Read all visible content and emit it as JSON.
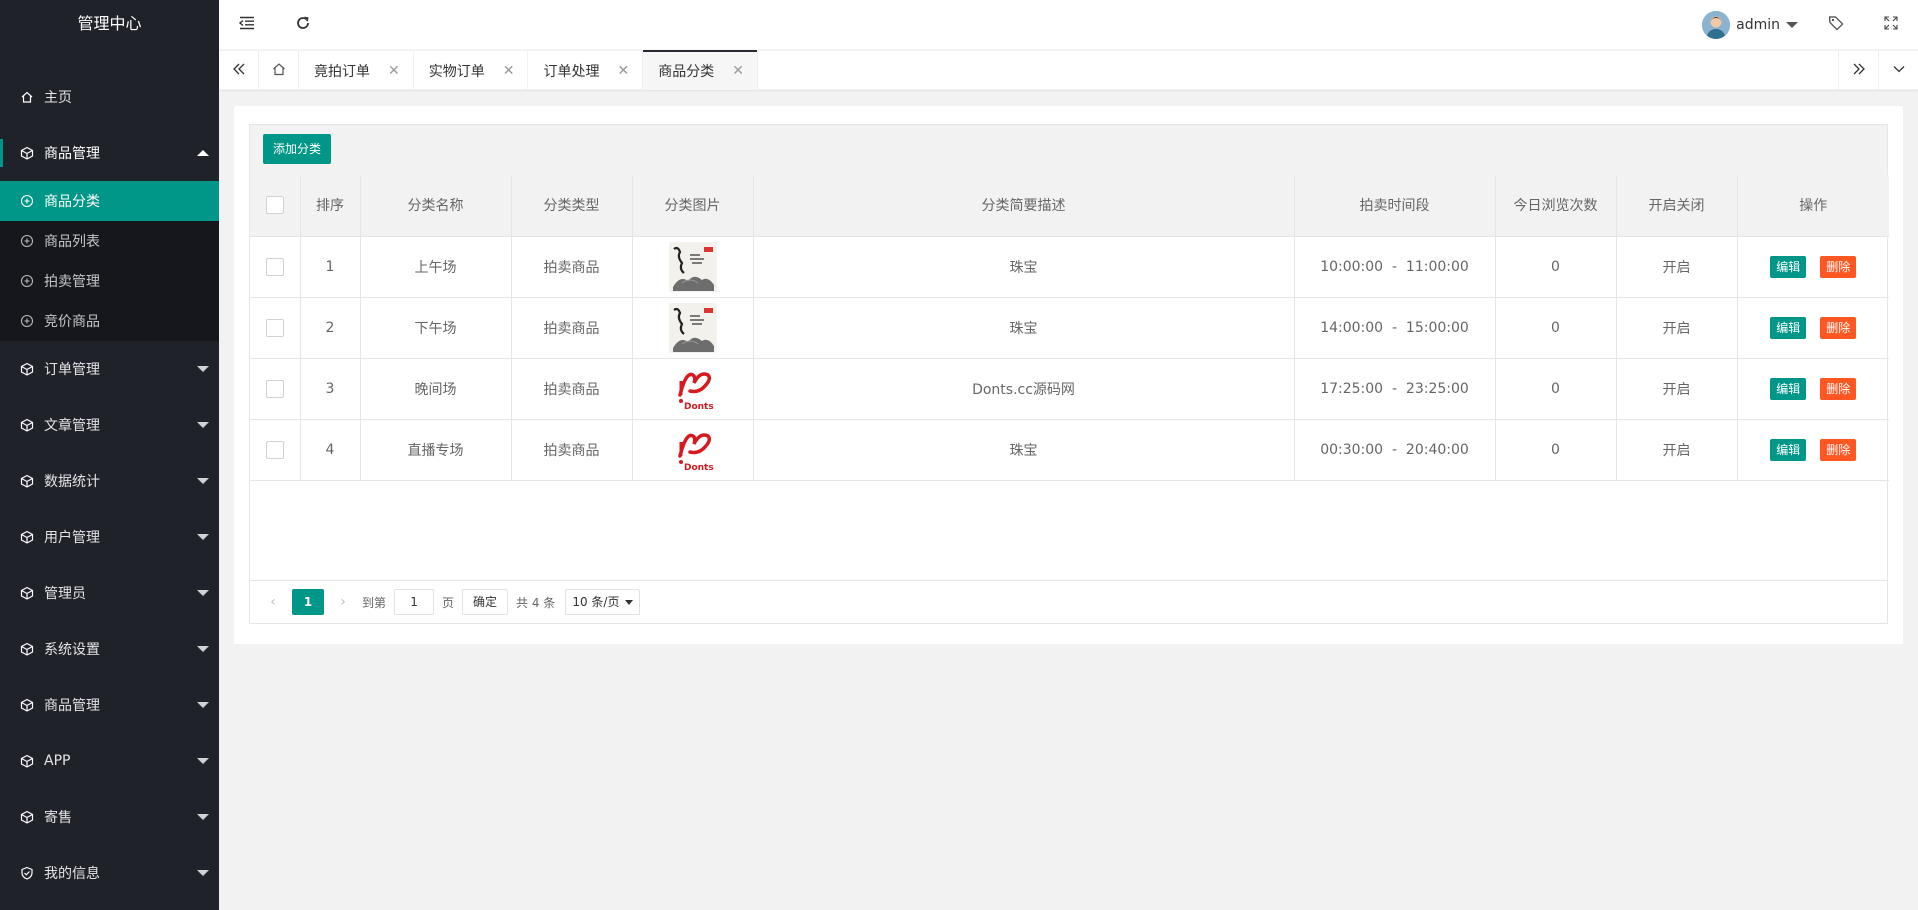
{
  "sidebar": {
    "title": "管理中心",
    "home": "主页",
    "menu": [
      {
        "label": "商品管理",
        "open": true,
        "children": [
          "商品分类",
          "商品列表",
          "拍卖管理",
          "竞价商品"
        ]
      },
      {
        "label": "订单管理"
      },
      {
        "label": "文章管理"
      },
      {
        "label": "数据统计"
      },
      {
        "label": "用户管理"
      },
      {
        "label": "管理员"
      },
      {
        "label": "系统设置"
      },
      {
        "label": "商品管理"
      },
      {
        "label": "APP"
      },
      {
        "label": "寄售"
      },
      {
        "label": "我的信息"
      }
    ]
  },
  "header": {
    "user": "admin"
  },
  "tabs": [
    {
      "label": "竟拍订单"
    },
    {
      "label": "实物订单"
    },
    {
      "label": "订单处理"
    },
    {
      "label": "商品分类",
      "active": true
    }
  ],
  "toolbar": {
    "add_label": "添加分类"
  },
  "table": {
    "headers": [
      "排序",
      "分类名称",
      "分类类型",
      "分类图片",
      "分类简要描述",
      "拍卖时间段",
      "今日浏览次数",
      "开启关闭",
      "操作"
    ],
    "rows": [
      {
        "order": "1",
        "name": "上午场",
        "type": "拍卖商品",
        "image": "ink-painting",
        "desc": "珠宝",
        "time": "10:00:00  -  11:00:00",
        "views": "0",
        "status": "开启"
      },
      {
        "order": "2",
        "name": "下午场",
        "type": "拍卖商品",
        "image": "ink-painting",
        "desc": "珠宝",
        "time": "14:00:00  -  15:00:00",
        "views": "0",
        "status": "开启"
      },
      {
        "order": "3",
        "name": "晚间场",
        "type": "拍卖商品",
        "image": "donts-logo",
        "desc": "Donts.cc源码网",
        "time": "17:25:00  -  23:25:00",
        "views": "0",
        "status": "开启"
      },
      {
        "order": "4",
        "name": "直播专场",
        "type": "拍卖商品",
        "image": "donts-logo",
        "desc": "珠宝",
        "time": "00:30:00  -  20:40:00",
        "views": "0",
        "status": "开启"
      }
    ],
    "edit_label": "编辑",
    "delete_label": "删除"
  },
  "pager": {
    "current": "1",
    "goto_label": "到第",
    "goto_value": "1",
    "page_label": "页",
    "confirm_label": "确定",
    "total_label": "共 4 条",
    "page_size": "10 条/页"
  },
  "colors": {
    "accent": "#009688",
    "danger": "#ff5722",
    "sidebar": "#20222a"
  }
}
